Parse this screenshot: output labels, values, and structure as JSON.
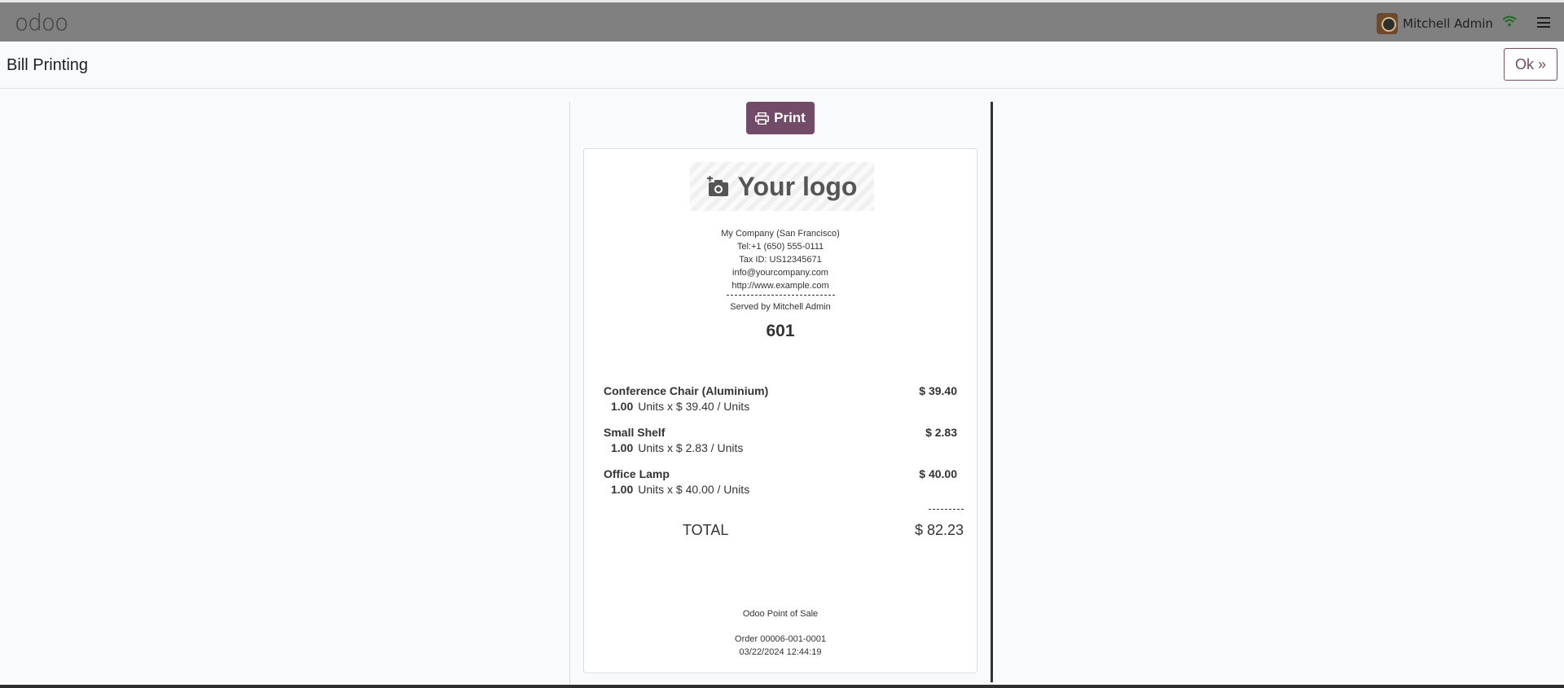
{
  "app": {
    "logo_text": "odoo"
  },
  "user": {
    "name": "Mitchell Admin"
  },
  "page": {
    "title": "Bill Printing",
    "ok_label": "Ok »"
  },
  "actions": {
    "print_label": "Print"
  },
  "receipt": {
    "logo_placeholder": "Your logo",
    "company_lines": [
      "My Company (San Francisco)",
      "Tel:+1 (650) 555-0111",
      "Tax ID: US12345671",
      "info@yourcompany.com",
      "http://www.example.com"
    ],
    "served_by": "Served by Mitchell Admin",
    "order_number": "601",
    "items": [
      {
        "name": "Conference Chair (Aluminium)",
        "price": "$ 39.40",
        "qty": "1.00",
        "detail": "Units x $ 39.40 / Units"
      },
      {
        "name": "Small Shelf",
        "price": "$ 2.83",
        "qty": "1.00",
        "detail": "Units x $ 2.83 / Units"
      },
      {
        "name": "Office Lamp",
        "price": "$ 40.00",
        "qty": "1.00",
        "detail": "Units x $ 40.00 / Units"
      }
    ],
    "total_label": "TOTAL",
    "total_value": "$ 82.23",
    "footer_brand": "Odoo Point of Sale",
    "footer_order": "Order 00006-001-0001",
    "footer_datetime": "03/22/2024 12:44:19"
  }
}
